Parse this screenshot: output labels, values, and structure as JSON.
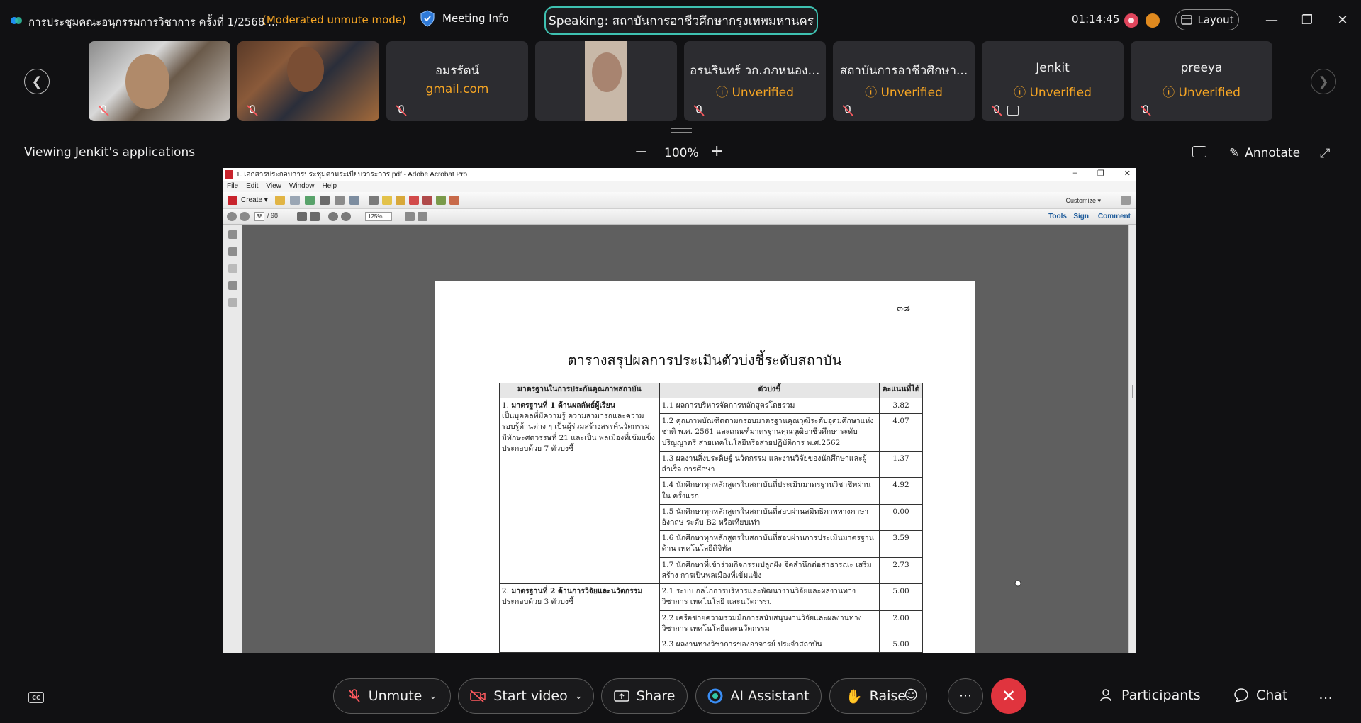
{
  "topbar": {
    "meeting_title": "การประชุมคณะอนุกรรมการวิชาการ ครั้งที่ 1/2568 ...",
    "mode": "(Moderated unmute mode)",
    "meeting_info": "Meeting Info",
    "speaking": "Speaking: สถาบันการอาชีวศึกษากรุงเทพมหานคร",
    "timer": "01:14:45",
    "layout": "Layout"
  },
  "participants": [
    {
      "name": "",
      "sub": "",
      "video": "a"
    },
    {
      "name": "",
      "sub": "",
      "video": "b"
    },
    {
      "name": "อมรรัตน์",
      "sub": "gmail.com",
      "video": ""
    },
    {
      "name": "",
      "sub": "",
      "video": "c"
    },
    {
      "name": "อรนรินทร์ วก.ภภหนองจ...",
      "sub": "Unverified",
      "video": ""
    },
    {
      "name": "สถาบันการอาชีวศึกษา...",
      "sub": "Unverified",
      "video": ""
    },
    {
      "name": "Jenkit",
      "sub": "Unverified",
      "video": ""
    },
    {
      "name": "preeya",
      "sub": "Unverified",
      "video": ""
    }
  ],
  "share": {
    "viewing": "Viewing Jenkit's applications",
    "zoom": "100%",
    "annotate": "Annotate"
  },
  "acrobat": {
    "window_title": "1. เอกสารประกอบการประชุมตามระเบียบวาระการ.pdf - Adobe Acrobat Pro",
    "menu": [
      "File",
      "Edit",
      "View",
      "Window",
      "Help"
    ],
    "create": "Create",
    "customize": "Customize",
    "page_current": "38",
    "page_total": "/ 98",
    "zoom": "125%",
    "tabs": [
      "Tools",
      "Sign",
      "Comment"
    ]
  },
  "document": {
    "page_number": "๓๘",
    "title": "ตารางสรุปผลการประเมินตัวบ่งชี้ระดับสถาบัน",
    "headers": [
      "มาตรฐานในการประกันคุณภาพสถาบัน",
      "ตัวบ่งชี้",
      "คะแนนที่ได้"
    ],
    "standards": [
      {
        "num": "1.",
        "head": "มาตรฐานที่ 1 ด้านผลลัพธ์ผู้เรียน",
        "desc": "เป็นบุคคลที่มีความรู้ ความสามารถและความรอบรู้ด้านต่าง ๆ เป็นผู้ร่วมสร้างสรรค์นวัตกรรม มีทักษะศตวรรษที่ 21 และเป็น พลเมืองที่เข้มแข็งประกอบด้วย 7 ตัวบ่งชี้",
        "indicators": [
          {
            "text": "1.1 ผลการบริหารจัดการหลักสูตรโดยรวม",
            "score": "3.82"
          },
          {
            "text": "1.2 คุณภาพบัณฑิตตามกรอบมาตรฐานคุณวุฒิระดับอุดมศึกษาแห่งชาติ พ.ศ. 2561 และเกณฑ์มาตรฐานคุณวุฒิอาชีวศึกษาระดับปริญญาตรี สายเทคโนโลยีหรือสายปฏิบัติการ พ.ศ.2562",
            "score": "4.07"
          },
          {
            "text": "1.3 ผลงานสิ่งประดิษฐ์ นวัตกรรม และงานวิจัยของนักศึกษาและผู้สำเร็จ การศึกษา",
            "score": "1.37"
          },
          {
            "text": "1.4 นักศึกษาทุกหลักสูตรในสถาบันที่ประเมินมาตรฐานวิชาชีพผ่านใน ครั้งแรก",
            "score": "4.92"
          },
          {
            "text": "1.5 นักศึกษาทุกหลักสูตรในสถาบันที่สอบผ่านสมิทธิภาพทางภาษาอังกฤษ ระดับ B2 หรือเทียบเท่า",
            "score": "0.00"
          },
          {
            "text": "1.6 นักศึกษาทุกหลักสูตรในสถาบันที่สอบผ่านการประเมินมาตรฐานด้าน เทคโนโลยีดิจิทัล",
            "score": "3.59"
          },
          {
            "text": "1.7 นักศึกษาที่เข้าร่วมกิจกรรมปลูกฝัง จิตสำนึกต่อสาธารณะ เสริมสร้าง การเป็นพลเมืองที่เข้มแข็ง",
            "score": "2.73"
          }
        ]
      },
      {
        "num": "2.",
        "head": "มาตรฐานที่ 2 ด้านการวิจัยและนวัตกรรม",
        "desc": "ประกอบด้วย 3 ตัวบ่งชี้",
        "indicators": [
          {
            "text": "2.1 ระบบ กลไกการบริหารและพัฒนางานวิจัยและผลงานทางวิชาการ เทคโนโลยี และนวัตกรรม",
            "score": "5.00"
          },
          {
            "text": "2.2 เครือข่ายความร่วมมือการสนับสนุนงานวิจัยและผลงานทางวิชาการ เทคโนโลยีและนวัตกรรม",
            "score": "2.00"
          },
          {
            "text": "2.3 ผลงานทางวิชาการของอาจารย์ ประจำสถาบัน",
            "score": "5.00"
          }
        ]
      }
    ]
  },
  "bottombar": {
    "cc": "CC",
    "unmute": "Unmute",
    "start_video": "Start video",
    "share": "Share",
    "ai_assistant": "AI Assistant",
    "raise": "Raise",
    "more": "···",
    "participants": "Participants",
    "chat": "Chat"
  },
  "colors": {
    "accent_orange": "#f5a524",
    "speaking_border": "#3ec1b1",
    "end_red": "#e0343e",
    "background": "#111113"
  }
}
